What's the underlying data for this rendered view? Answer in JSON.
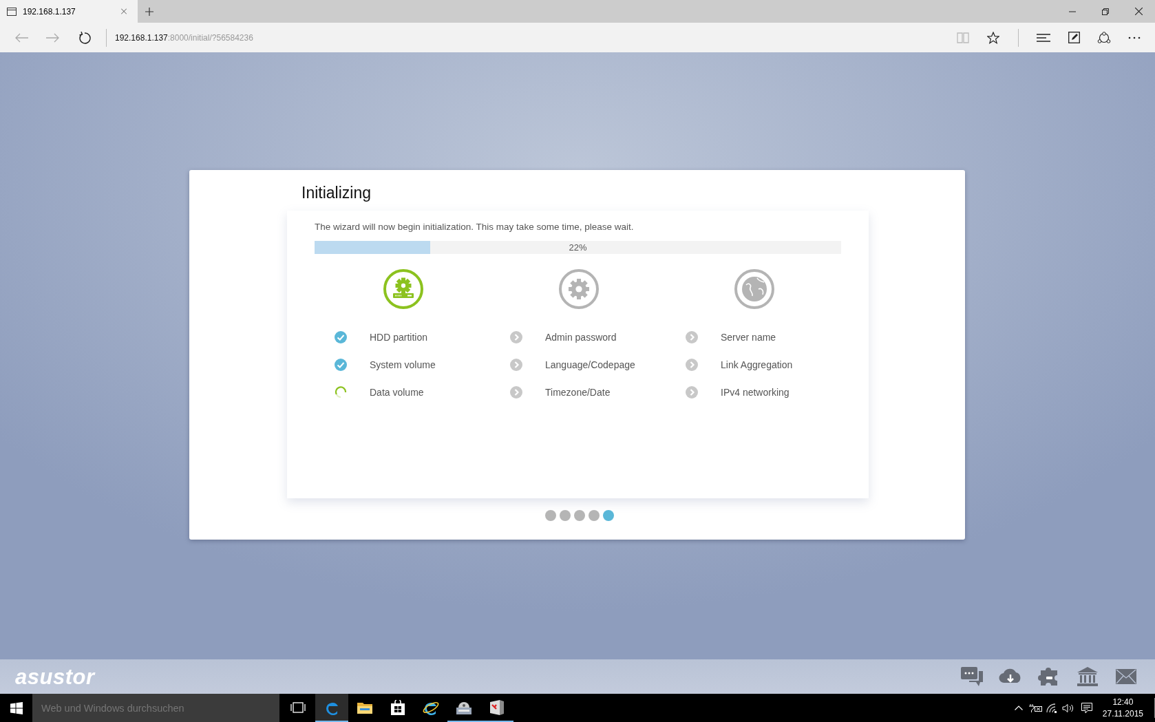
{
  "browser": {
    "tab": {
      "title": "192.168.1.137"
    },
    "address": {
      "host": "192.168.1.137",
      "path": ":8000/initial/?56584236"
    }
  },
  "wizard": {
    "title": "Initializing",
    "message": "The wizard will now begin initialization. This may take some time, please wait.",
    "progress": {
      "level": 0.22,
      "reading": "22%"
    },
    "columns": [
      {
        "kind": "setup",
        "active": true,
        "steps": [
          {
            "label": "HDD partition",
            "kind": "done"
          },
          {
            "label": "System volume",
            "kind": "done"
          },
          {
            "label": "Data volume",
            "kind": "running"
          }
        ]
      },
      {
        "kind": "system",
        "active": false,
        "steps": [
          {
            "label": "Admin password",
            "kind": "pending"
          },
          {
            "label": "Language/Codepage",
            "kind": "pending"
          },
          {
            "label": "Timezone/Date",
            "kind": "pending"
          }
        ]
      },
      {
        "kind": "network",
        "active": false,
        "steps": [
          {
            "label": "Server name",
            "kind": "pending"
          },
          {
            "label": "Link Aggregation",
            "kind": "pending"
          },
          {
            "label": "IPv4 networking",
            "kind": "pending"
          }
        ]
      }
    ],
    "pages": [
      {
        "selected": false
      },
      {
        "selected": false
      },
      {
        "selected": false
      },
      {
        "selected": false
      },
      {
        "selected": true
      }
    ]
  },
  "footer": {
    "logo": "asustor"
  },
  "taskbar": {
    "search": {
      "placeholder": "Web und Windows durchsuchen"
    },
    "time": "12:40",
    "date": "27.11.2015"
  }
}
